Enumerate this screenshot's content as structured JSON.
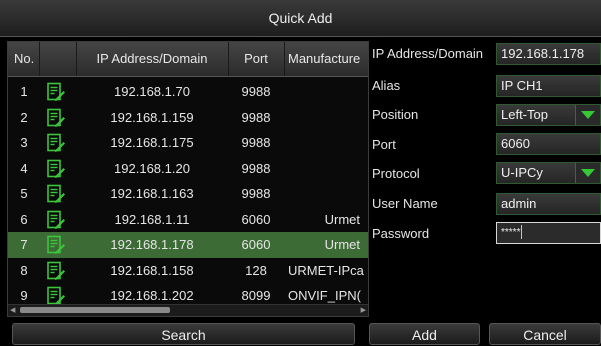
{
  "window": {
    "title": "Quick Add"
  },
  "table": {
    "columns": [
      "No.",
      "",
      "IP Address/Domain",
      "Port",
      "Manufacture"
    ],
    "rows": [
      {
        "no": "1",
        "ip": "192.168.1.70",
        "port": "9988",
        "mfr": ""
      },
      {
        "no": "2",
        "ip": "192.168.1.159",
        "port": "9988",
        "mfr": ""
      },
      {
        "no": "3",
        "ip": "192.168.1.175",
        "port": "9988",
        "mfr": ""
      },
      {
        "no": "4",
        "ip": "192.168.1.20",
        "port": "9988",
        "mfr": ""
      },
      {
        "no": "5",
        "ip": "192.168.1.163",
        "port": "9988",
        "mfr": ""
      },
      {
        "no": "6",
        "ip": "192.168.1.11",
        "port": "6060",
        "mfr": "Urmet"
      },
      {
        "no": "7",
        "ip": "192.168.1.178",
        "port": "6060",
        "mfr": "Urmet"
      },
      {
        "no": "8",
        "ip": "192.168.1.158",
        "port": "128",
        "mfr": "URMET-IPca"
      },
      {
        "no": "9",
        "ip": "192.168.1.202",
        "port": "8099",
        "mfr": "ONVIF_IPN("
      }
    ],
    "selected_row": 6
  },
  "form": {
    "ip": {
      "label": "IP Address/Domain",
      "value": "192.168.1.178"
    },
    "alias": {
      "label": "Alias",
      "value": "IP CH1"
    },
    "position": {
      "label": "Position",
      "value": "Left-Top"
    },
    "port": {
      "label": "Port",
      "value": "6060"
    },
    "protocol": {
      "label": "Protocol",
      "value": "U-IPCy"
    },
    "username": {
      "label": "User Name",
      "value": "admin"
    },
    "password": {
      "label": "Password",
      "value": "*****"
    }
  },
  "buttons": {
    "search": "Search",
    "add": "Add",
    "cancel": "Cancel"
  },
  "icons": {
    "edit": "edit-document-icon",
    "dropdown": "dropdown-arrow-icon"
  },
  "colors": {
    "selected_row": "#3d6b36",
    "accent_green": "#36c936",
    "field_border": "#2f5a2f"
  }
}
